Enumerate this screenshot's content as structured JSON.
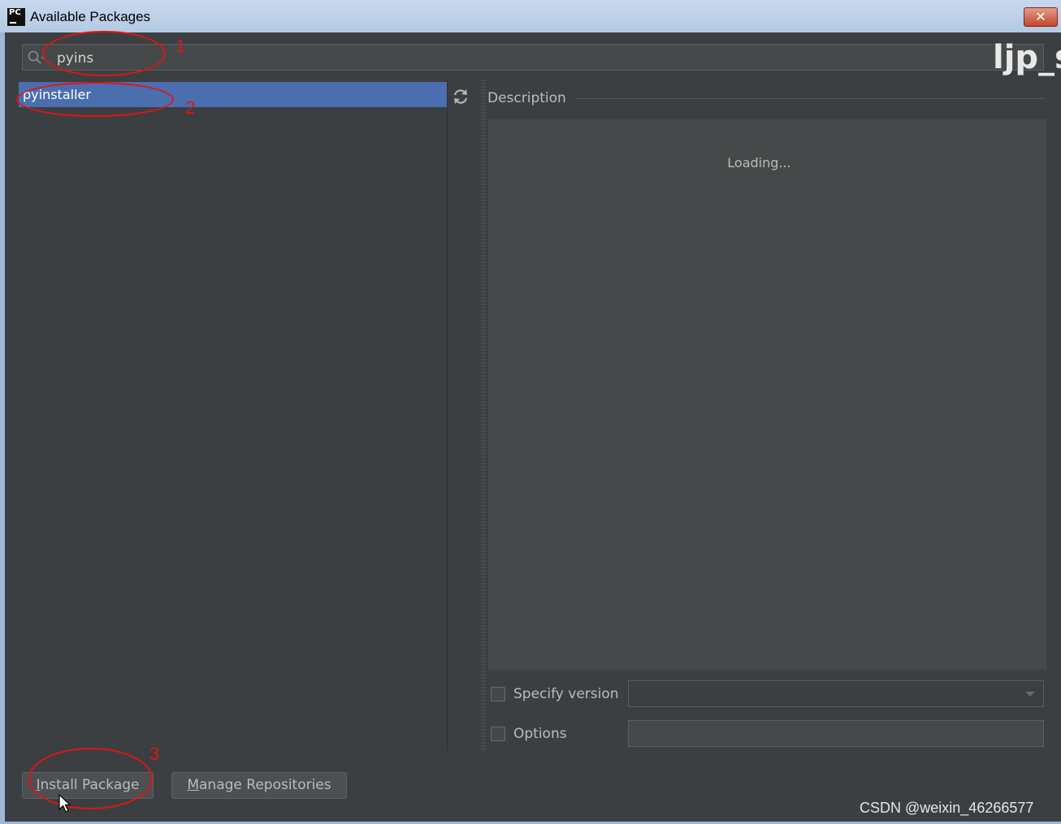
{
  "window": {
    "app_icon_text": "PC",
    "title": "Available Packages",
    "close_glyph": "✕"
  },
  "search": {
    "value": "pyins",
    "icon": "search-icon"
  },
  "package_list": {
    "items": [
      {
        "label": "pyinstaller",
        "selected": true
      }
    ],
    "refresh_icon": "refresh-icon"
  },
  "description": {
    "label": "Description",
    "loading_text": "Loading..."
  },
  "specify_version": {
    "label": "Specify version",
    "checked": false,
    "value": ""
  },
  "options": {
    "label": "Options",
    "checked": false,
    "value": ""
  },
  "buttons": {
    "install": {
      "mnemonic": "I",
      "rest": "nstall Package"
    },
    "manage": {
      "mnemonic": "M",
      "rest": "anage Repositories"
    }
  },
  "annotations": [
    "1",
    "2",
    "3"
  ],
  "watermarks": {
    "user_overlay": "ljp_s",
    "csdn": "CSDN @weixin_46266577"
  },
  "colors": {
    "dialog_bg": "#3c3f41",
    "selection": "#4b6eaf",
    "annotation": "#e01515"
  }
}
